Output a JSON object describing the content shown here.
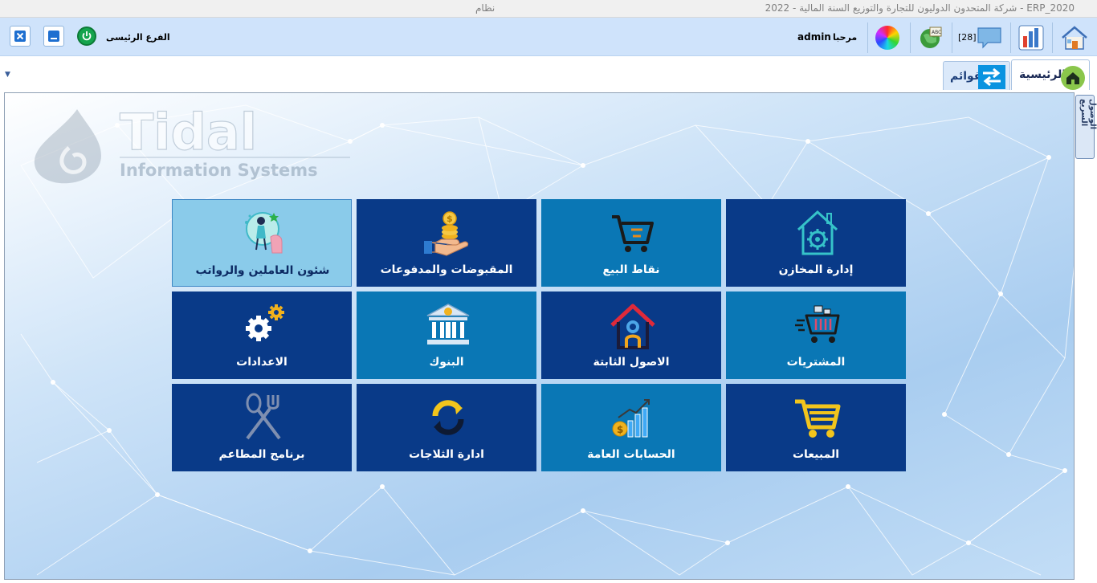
{
  "window": {
    "title": "ERP_2020 - شركة المتحدون الدوليون للتجارة والتوزيع السنة المالية - 2022",
    "menu_label": "نظام"
  },
  "toolbar": {
    "branch_label": "الفرع الرئيسى",
    "welcome_label": "مرحبا",
    "user_name": "admin",
    "message_count": "[28]"
  },
  "tabs": [
    {
      "label": "الرئيسية",
      "icon": "home-icon"
    },
    {
      "label": "القوائم",
      "icon": "swap-arrows-icon"
    }
  ],
  "logo": {
    "name": "Tidal",
    "subtitle": "Information Systems"
  },
  "quick_access_label": "الوصول السريع",
  "tiles": [
    {
      "label": "إدارة المخازن",
      "icon": "warehouse-gear-icon",
      "style": "dark"
    },
    {
      "label": "نقاط البيع",
      "icon": "cart-icon",
      "style": "mid"
    },
    {
      "label": "المقبوضات والمدفوعات",
      "icon": "coins-hand-icon",
      "style": "dark"
    },
    {
      "label": "شئون العاملين والرواتب",
      "icon": "employee-icon",
      "style": "light"
    },
    {
      "label": "المشتريات",
      "icon": "purchase-cart-icon",
      "style": "mid"
    },
    {
      "label": "الاصول الثابتة",
      "icon": "fixed-asset-house-icon",
      "style": "dark"
    },
    {
      "label": "البنوك",
      "icon": "bank-icon",
      "style": "mid"
    },
    {
      "label": "الاعدادات",
      "icon": "gears-icon",
      "style": "dark"
    },
    {
      "label": "المبيعات",
      "icon": "sales-cart-icon",
      "style": "dark"
    },
    {
      "label": "الحسابات العامة",
      "icon": "accounts-chart-icon",
      "style": "mid"
    },
    {
      "label": "ادارة الثلاجات",
      "icon": "refresh-cycle-icon",
      "style": "dark"
    },
    {
      "label": "برنامج المطاعم",
      "icon": "fork-knife-icon",
      "style": "dark"
    }
  ],
  "colors": {
    "tile_dark": "#093a88",
    "tile_mid": "#0a77b5",
    "tile_light": "#8acbea",
    "toolbar_bg": "#cfe3fb"
  }
}
